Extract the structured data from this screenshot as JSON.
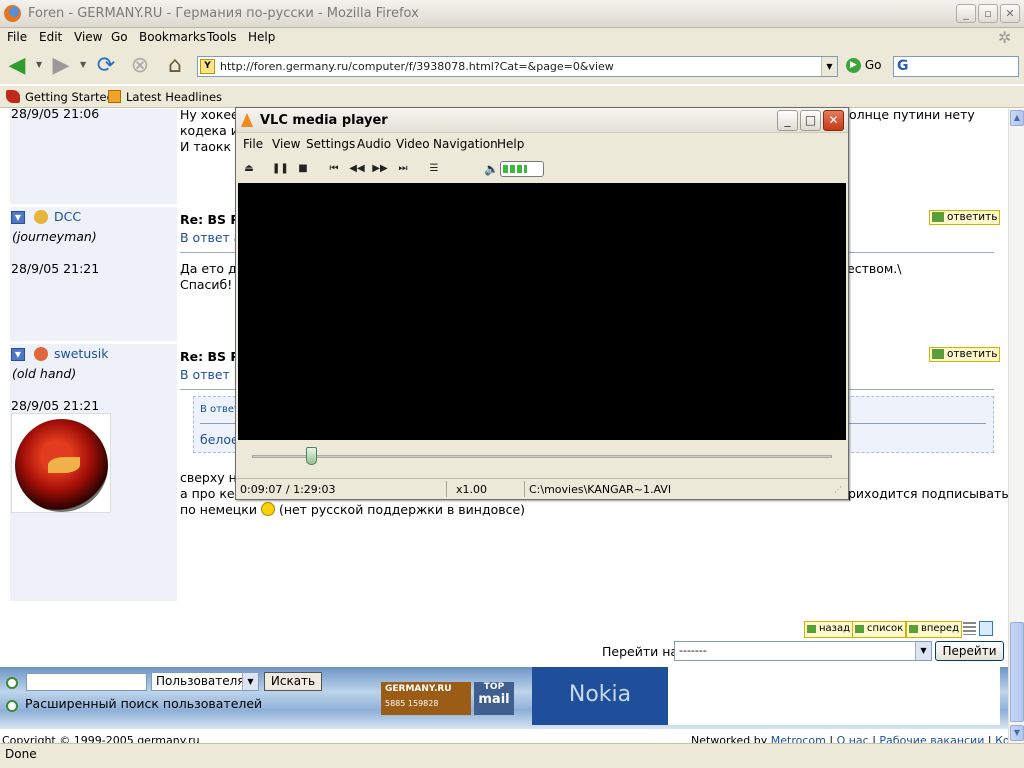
{
  "window": {
    "title": "Foren - GERMANY.RU - Германия по-русски - Mozilla Firefox"
  },
  "menu": [
    "File",
    "Edit",
    "View",
    "Go",
    "Bookmarks",
    "Tools",
    "Help"
  ],
  "navbar": {
    "url": "http://foren.germany.ru/computer/f/3938078.html?Cat=&page=0&view",
    "go_label": "Go"
  },
  "bookmarks": [
    "Getting Started",
    "Latest Headlines"
  ],
  "forum": {
    "post1": {
      "time": "28/9/05 21:06",
      "line1a": "Ну хокее",
      "line1b": "олнце путини нету",
      "line2": "кодека и",
      "line3": "И таокк н"
    },
    "post2": {
      "user": "DCC",
      "rank": "(journeyman)",
      "time": "28/9/05 21:21",
      "title": "Re: BS P",
      "reply_to": "В ответ а",
      "line1a": "Да ето де",
      "line1b": "еством.\\",
      "line2": "Спасиб!",
      "reply_btn": "ответить"
    },
    "post3": {
      "user": "swetusik",
      "rank": "(old hand)",
      "time": "28/9/05 21:21",
      "title": "Re: BS P",
      "reply_to": "В ответ D",
      "quote_head": "В ответ",
      "quote_text": "белое",
      "line1": "сверху на",
      "line2a": "а про кен",
      "line2b": "риходится подписывать",
      "line3": "по немецки",
      "line3b": "(нет русской поддержки в виндовсе)",
      "reply_btn": "ответить"
    },
    "nav": {
      "back": "назад",
      "list": "список",
      "forward": "вперед"
    },
    "goto_label": "Перейти на",
    "goto_value": "-------",
    "goto_button": "Перейти"
  },
  "banner": {
    "select_value": "Пользователя",
    "search_button": "Искать",
    "extended_search": "Расширенный поиск пользователей",
    "logo_left": "GERMANY.RU",
    "logo_counter_a": "5885",
    "logo_counter_b": "159828",
    "logo_top": "TOP",
    "logo_mail": "mail",
    "ad": "Nokia"
  },
  "footer": {
    "copyright": "Copyright © 1999-2005 germany.ru",
    "networked_by": "Networked by",
    "links": [
      "Metrocom",
      "О нас",
      "Рабочие вакансии",
      "Контакт"
    ]
  },
  "status": "Done",
  "vlc": {
    "title": "VLC media player",
    "menu": [
      "File",
      "View",
      "Settings",
      "Audio",
      "Video",
      "Navigation",
      "Help"
    ],
    "elapsed": "0:09:07 / 1:29:03",
    "speed": "x1.00",
    "file": "C:\\movies\\KANGAR~1.AVI",
    "progress": 0.102,
    "volume": 0.6
  }
}
